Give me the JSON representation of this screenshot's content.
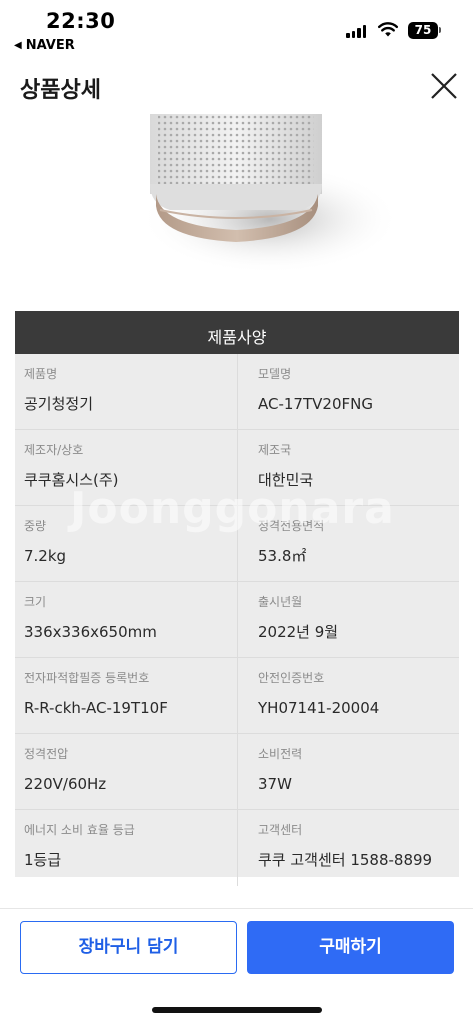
{
  "status_bar": {
    "time": "22:30",
    "back_app": "NAVER",
    "battery": "75"
  },
  "header": {
    "title": "상품상세",
    "close_icon": "close-icon"
  },
  "spec": {
    "title": "제품사양",
    "watermark": "Joonggonara",
    "rows": [
      [
        {
          "label": "제품명",
          "value": "공기청정기"
        },
        {
          "label": "모델명",
          "value": "AC-17TV20FNG"
        }
      ],
      [
        {
          "label": "제조자/상호",
          "value": "쿠쿠홈시스(주)"
        },
        {
          "label": "제조국",
          "value": "대한민국"
        }
      ],
      [
        {
          "label": "중량",
          "value": "7.2kg"
        },
        {
          "label": "정격전용면적",
          "value": "53.8㎡"
        }
      ],
      [
        {
          "label": "크기",
          "value": "336x336x650mm"
        },
        {
          "label": "출시년월",
          "value": "2022년 9월"
        }
      ],
      [
        {
          "label": "전자파적합필증 등록번호",
          "value": "R-R-ckh-AC-19T10F"
        },
        {
          "label": "안전인증번호",
          "value": "YH07141-20004"
        }
      ],
      [
        {
          "label": "정격전압",
          "value": "220V/60Hz"
        },
        {
          "label": "소비전력",
          "value": "37W"
        }
      ],
      [
        {
          "label": "에너지 소비 효율 등급",
          "value": "1등급"
        },
        {
          "label": "고객센터",
          "value": "쿠쿠 고객센터 1588-8899"
        }
      ]
    ]
  },
  "actions": {
    "cart_label": "장바구니 담기",
    "buy_label": "구매하기",
    "cart_color": "#2a6bf2",
    "buy_color": "#2f6bf5"
  }
}
